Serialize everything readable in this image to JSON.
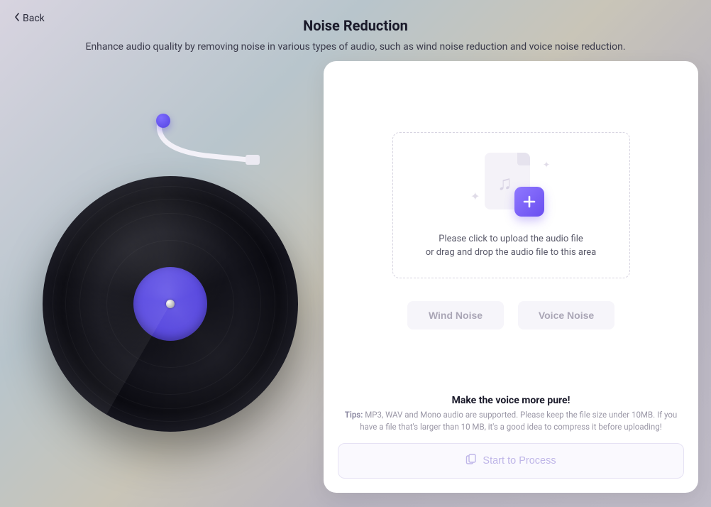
{
  "nav": {
    "back_label": "Back"
  },
  "header": {
    "title": "Noise Reduction",
    "subtitle": "Enhance audio quality by removing noise in various types of audio, such as wind noise reduction and voice noise reduction."
  },
  "upload": {
    "line1": "Please click to upload the audio file",
    "line2": "or drag and drop the audio file to this area"
  },
  "noise_modes": {
    "wind": "Wind Noise",
    "voice": "Voice Noise"
  },
  "tips": {
    "heading": "Make the voice more pure!",
    "label": "Tips:",
    "body": "MP3, WAV and Mono audio are supported. Please keep the file size under 10MB. If you have a file that's larger than 10 MB, it's a good idea to compress it before uploading!"
  },
  "actions": {
    "process": "Start to Process"
  }
}
